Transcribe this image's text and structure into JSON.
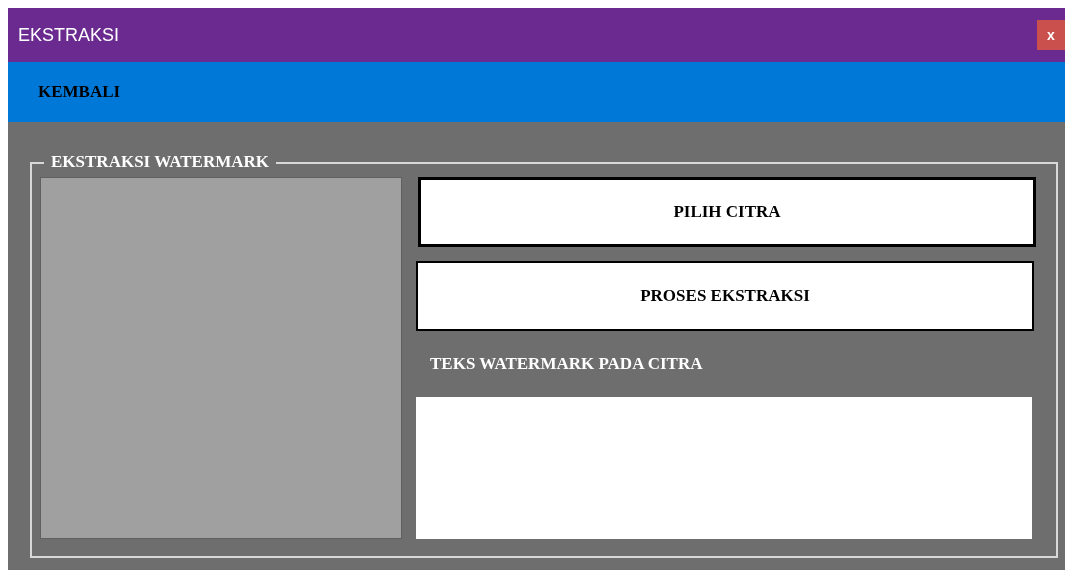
{
  "window": {
    "title": "EKSTRAKSI",
    "close": "x"
  },
  "menu": {
    "label": "KEMBALI"
  },
  "group": {
    "title": "EKSTRAKSI WATERMARK",
    "buttons": [
      {
        "label": "PILIH CITRA",
        "focused": true
      },
      {
        "label": "PROSES EKSTRAKSI",
        "focused": false
      }
    ],
    "result_label": "TEKS WATERMARK PADA CITRA"
  }
}
